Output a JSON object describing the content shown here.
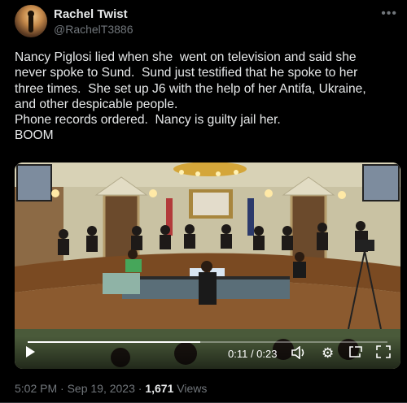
{
  "author": {
    "name": "Rachel Twist",
    "handle": "@RachelT3886"
  },
  "more_icon": "more-horizontal-icon",
  "tweet": {
    "text": "Nancy Piglosi lied when she  went on television and said she\nnever spoke to Sund.  Sund just testified that he spoke to her\nthree times.  She set up J6 with the help of her Antifa, Ukraine,\nand other despicable people.\nPhone records ordered.  Nancy is guilty jail her.\nBOOM"
  },
  "video": {
    "time_display": "0:11 / 0:23",
    "progress": 0.48,
    "controls": [
      "play-icon",
      "volume-icon",
      "settings-icon",
      "pop-out-icon",
      "fullscreen-icon"
    ]
  },
  "meta": {
    "timestamp": "5:02 PM · Sep 19, 2023 ·",
    "views_count": "1,671",
    "views_label": "Views"
  }
}
